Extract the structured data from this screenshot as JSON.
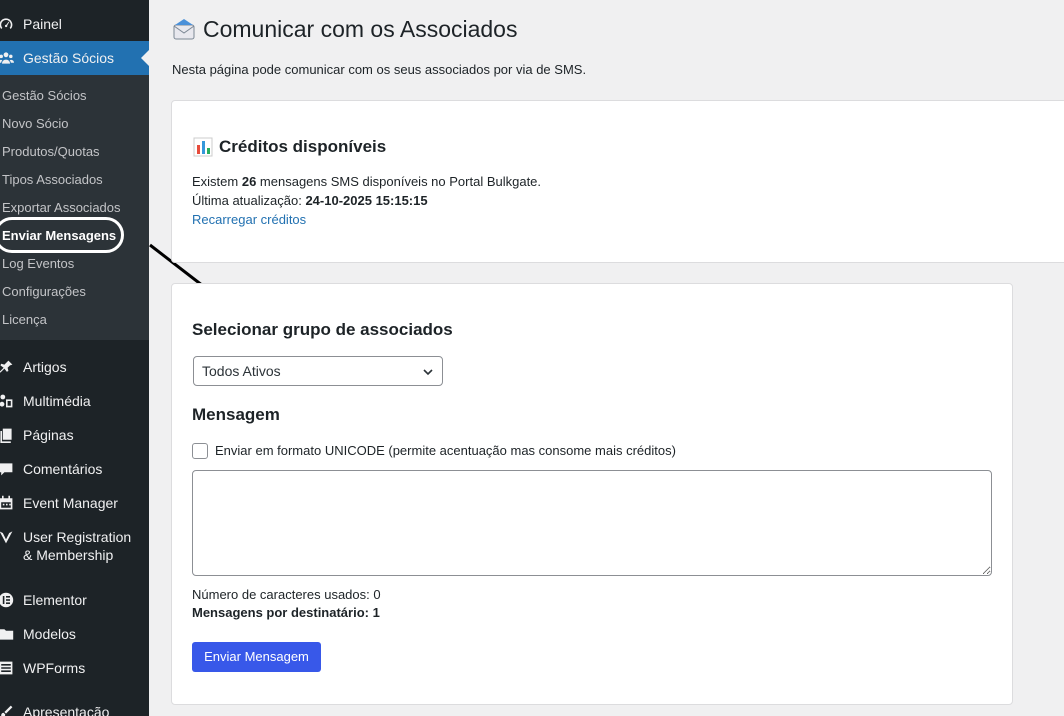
{
  "sidebar": {
    "top_items": [
      {
        "label": "Painel",
        "icon": "dashboard-icon"
      },
      {
        "label": "Gestão Sócios",
        "icon": "users-icon"
      },
      {
        "label": "Artigos",
        "icon": "pin-icon"
      },
      {
        "label": "Multimédia",
        "icon": "media-icon"
      },
      {
        "label": "Páginas",
        "icon": "pages-icon"
      },
      {
        "label": "Comentários",
        "icon": "comment-icon"
      },
      {
        "label": "Event Manager",
        "icon": "calendar-icon"
      },
      {
        "label": "User Registration & Membership",
        "icon": "ur-logo-icon"
      },
      {
        "label": "Elementor",
        "icon": "elementor-icon"
      },
      {
        "label": "Modelos",
        "icon": "folder-icon"
      },
      {
        "label": "WPForms",
        "icon": "forms-icon"
      },
      {
        "label": "Apresentação",
        "icon": "brush-icon"
      }
    ],
    "sub_items": [
      {
        "label": "Gestão Sócios"
      },
      {
        "label": "Novo Sócio"
      },
      {
        "label": "Produtos/Quotas"
      },
      {
        "label": "Tipos Associados"
      },
      {
        "label": "Exportar Associados"
      },
      {
        "label": "Enviar Mensagens"
      },
      {
        "label": "Log Eventos"
      },
      {
        "label": "Configurações"
      },
      {
        "label": "Licença"
      }
    ]
  },
  "page": {
    "title": "Comunicar com os Associados",
    "description": "Nesta página pode comunicar com os seus associados por via de SMS."
  },
  "credits": {
    "heading": "Créditos disponíveis",
    "line1_prefix": "Existem ",
    "count": "26",
    "line1_suffix": " mensagens SMS disponíveis no Portal Bulkgate.",
    "updated_label": "Última atualização: ",
    "updated_value": "24-10-2025 15:15:15",
    "reload_link": "Recarregar créditos"
  },
  "send": {
    "group_heading": "Selecionar grupo de associados",
    "group_selected": "Todos Ativos",
    "message_heading": "Mensagem",
    "unicode_label": "Enviar em formato UNICODE (permite acentuação mas consome mais créditos)",
    "message_value": "",
    "char_count_label": "Número de caracteres usados: 0",
    "per_recipient_label": "Mensagens por destinatário: 1",
    "button_label": "Enviar Mensagem"
  },
  "colors": {
    "sidebar_bg": "#1d2327",
    "submenu_bg": "#2c3338",
    "active_blue": "#2271b1",
    "button_blue": "#3858e9"
  }
}
